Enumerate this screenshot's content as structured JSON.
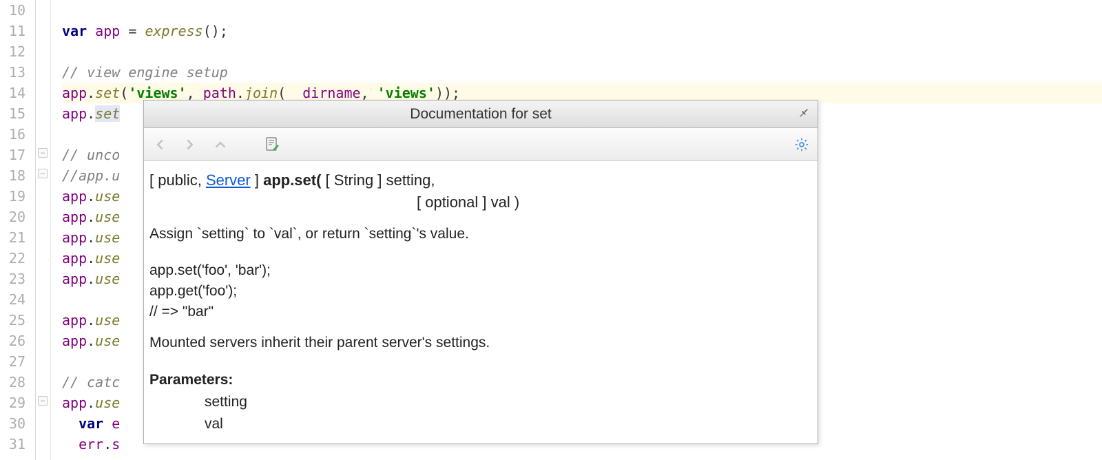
{
  "gutter": {
    "start": 10,
    "end": 31
  },
  "code_lines": [
    {
      "n": 10,
      "html": ""
    },
    {
      "n": 11,
      "html": "<span class='kw'>var</span> <span class='var'>app</span> <span class='op'>=</span> <span class='fn'>express</span><span class='op'>();</span>"
    },
    {
      "n": 12,
      "html": ""
    },
    {
      "n": 13,
      "html": "<span class='cmt'>// view engine setup</span>"
    },
    {
      "n": 14,
      "hl": true,
      "html": "<span class='var'>app</span><span class='op'>.</span><span class='fn'>set</span><span class='op'>(</span><span class='str'>'views'</span><span class='op'>,</span> <span class='var'>path</span><span class='op'>.</span><span class='fn'>join</span><span class='op'>(</span><span class='var'>__dirname</span><span class='op'>,</span> <span class='str'>'views'</span><span class='op'>));</span>"
    },
    {
      "n": 15,
      "html": "<span class='var'>app</span><span class='op'>.</span><span class='fn hlspan'>set</span>"
    },
    {
      "n": 16,
      "html": ""
    },
    {
      "n": 17,
      "html": "<span class='cmt'>// unco</span>"
    },
    {
      "n": 18,
      "html": "<span class='cmt'>//app.u</span>"
    },
    {
      "n": 19,
      "html": "<span class='var'>app</span><span class='op'>.</span><span class='fn'>use</span>"
    },
    {
      "n": 20,
      "html": "<span class='var'>app</span><span class='op'>.</span><span class='fn'>use</span>"
    },
    {
      "n": 21,
      "html": "<span class='var'>app</span><span class='op'>.</span><span class='fn'>use</span>"
    },
    {
      "n": 22,
      "html": "<span class='var'>app</span><span class='op'>.</span><span class='fn'>use</span>"
    },
    {
      "n": 23,
      "html": "<span class='var'>app</span><span class='op'>.</span><span class='fn'>use</span>"
    },
    {
      "n": 24,
      "html": ""
    },
    {
      "n": 25,
      "html": "<span class='var'>app</span><span class='op'>.</span><span class='fn'>use</span>"
    },
    {
      "n": 26,
      "html": "<span class='var'>app</span><span class='op'>.</span><span class='fn'>use</span>"
    },
    {
      "n": 27,
      "html": ""
    },
    {
      "n": 28,
      "html": "<span class='cmt'>// catc</span>"
    },
    {
      "n": 29,
      "html": "<span class='var'>app</span><span class='op'>.</span><span class='fn'>use</span>"
    },
    {
      "n": 30,
      "html": "  <span class='kw'>var</span> <span class='var'>e</span>"
    },
    {
      "n": 31,
      "html": "  <span class='var'>err</span><span class='op'>.</span><span class='var'>s</span>"
    }
  ],
  "doc": {
    "title": "Documentation for set",
    "sig_prefix": "[ public, ",
    "sig_link": "Server",
    "sig_after_link": " ]  ",
    "sig_call": "app.set(",
    "sig_p1": " [ String ] setting,",
    "sig_p2": "[ optional ] val )",
    "desc": "Assign `setting` to `val`, or return `setting`'s value.",
    "ex1": "app.set('foo', 'bar');",
    "ex2": "app.get('foo');",
    "ex3": "// => \"bar\"",
    "note": "Mounted servers inherit their parent server's settings.",
    "params_h": "Parameters:",
    "param1": "setting",
    "param2": "val"
  }
}
